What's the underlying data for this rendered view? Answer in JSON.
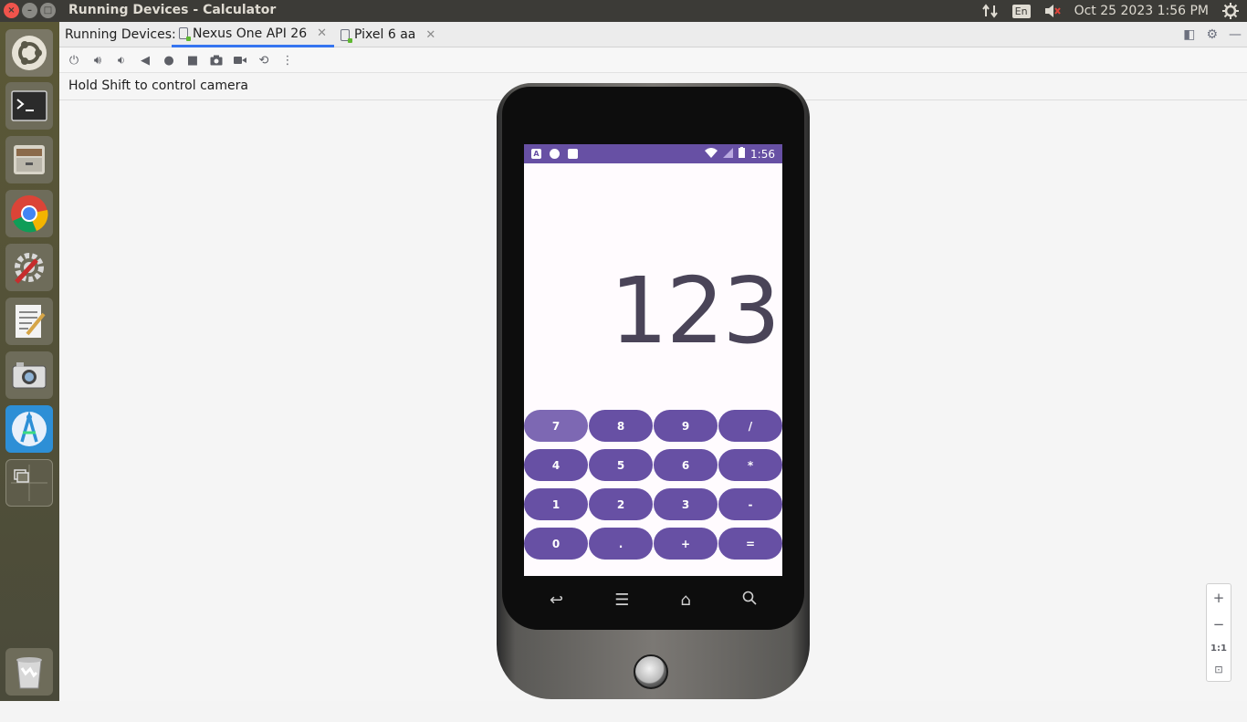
{
  "window": {
    "title": "Running Devices - Calculator"
  },
  "system": {
    "language": "En",
    "datetime": "Oct 25 2023  1:56 PM"
  },
  "launcher": {
    "items": [
      {
        "name": "ubuntu-dash"
      },
      {
        "name": "terminal"
      },
      {
        "name": "files"
      },
      {
        "name": "chrome"
      },
      {
        "name": "system-settings"
      },
      {
        "name": "text-editor"
      },
      {
        "name": "screenshot"
      },
      {
        "name": "android-studio"
      },
      {
        "name": "workspace-switcher"
      },
      {
        "name": "trash"
      }
    ]
  },
  "devices_panel": {
    "label": "Running Devices:",
    "tabs": [
      {
        "label": "Nexus One API 26",
        "active": true
      },
      {
        "label": "Pixel 6 aa",
        "active": false
      }
    ],
    "hint": "Hold Shift to control camera"
  },
  "phone": {
    "status_time": "1:56",
    "display_value": "123",
    "keys": [
      "7",
      "8",
      "9",
      "/",
      "4",
      "5",
      "6",
      "*",
      "1",
      "2",
      "3",
      "-",
      "0",
      ".",
      "+",
      "="
    ],
    "pressed_key": "7",
    "accent_color": "#6750a4"
  },
  "zoom": {
    "plus": "+",
    "minus": "−",
    "one_to_one": "1:1"
  }
}
